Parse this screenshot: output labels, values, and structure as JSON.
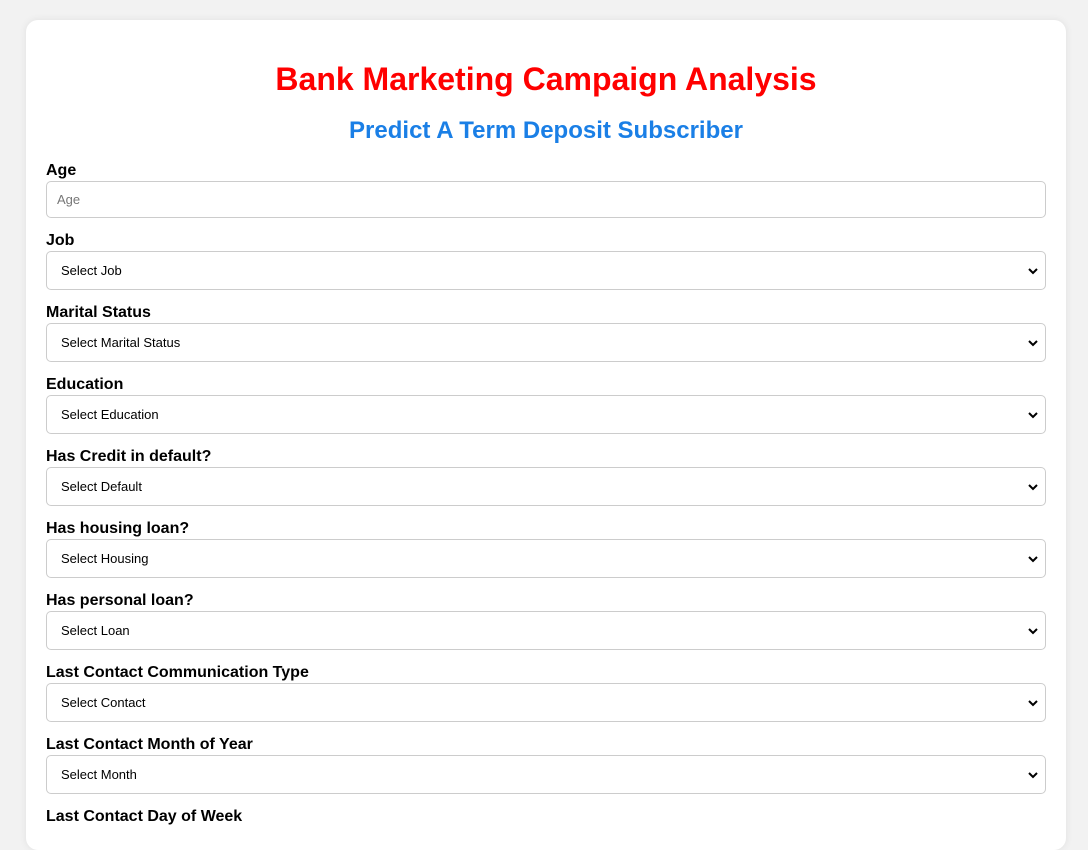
{
  "header": {
    "title": "Bank Marketing Campaign Analysis",
    "subtitle": "Predict A Term Deposit Subscriber"
  },
  "colors": {
    "title": "#ff0000",
    "subtitle": "#1a7fe6",
    "background": "#f2f2f2",
    "card": "#ffffff",
    "border": "#cccccc"
  },
  "form": {
    "age": {
      "label": "Age",
      "placeholder": "Age",
      "value": ""
    },
    "job": {
      "label": "Job",
      "selected": "Select Job"
    },
    "marital": {
      "label": "Marital Status",
      "selected": "Select Marital Status"
    },
    "education": {
      "label": "Education",
      "selected": "Select Education"
    },
    "default": {
      "label": "Has Credit in default?",
      "selected": "Select Default"
    },
    "housing": {
      "label": "Has housing loan?",
      "selected": "Select Housing"
    },
    "loan": {
      "label": "Has personal loan?",
      "selected": "Select Loan"
    },
    "contact": {
      "label": "Last Contact Communication Type",
      "selected": "Select Contact"
    },
    "month": {
      "label": "Last Contact Month of Year",
      "selected": "Select Month"
    },
    "day_of_week": {
      "label": "Last Contact Day of Week"
    }
  },
  "icons": {
    "dropdown": "chevron-down-icon"
  }
}
